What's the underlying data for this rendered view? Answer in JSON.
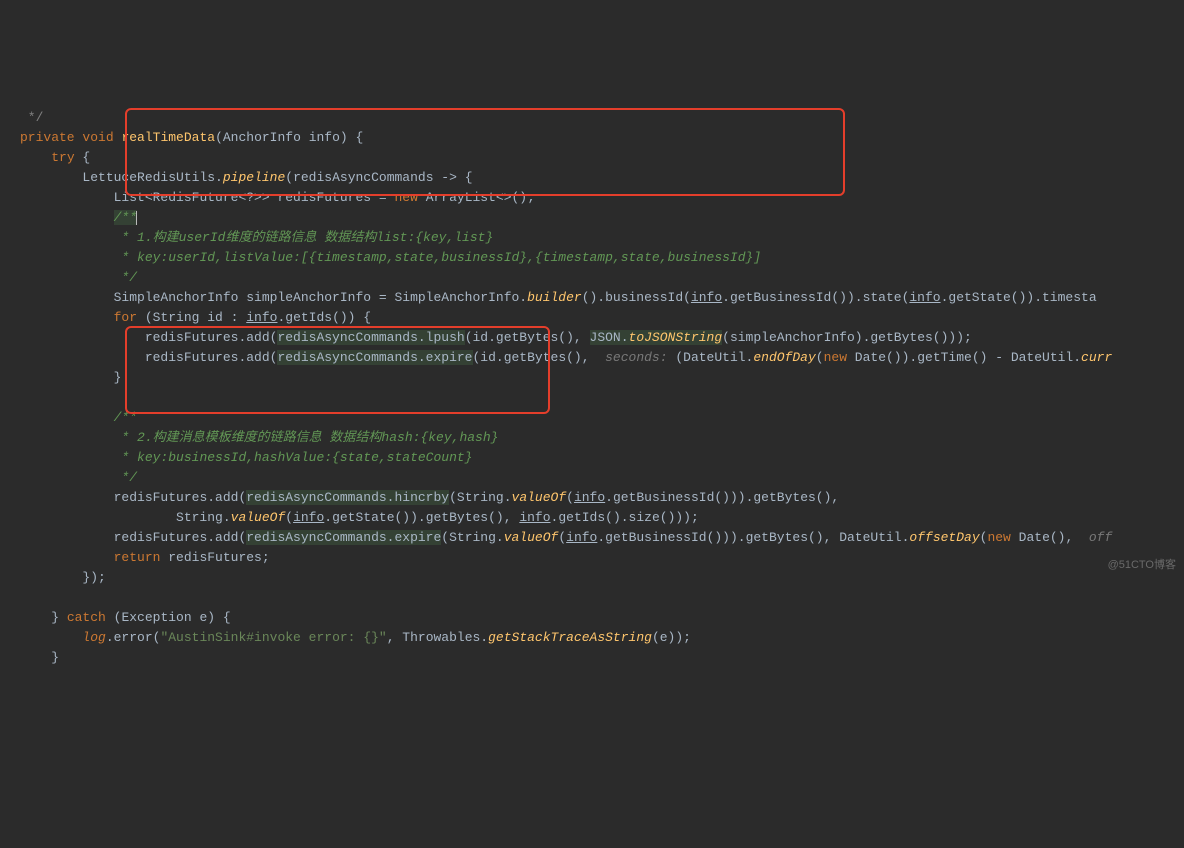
{
  "code": {
    "l01": " */",
    "l02a": "private",
    "l02b": "void",
    "l02c": "realTimeData",
    "l02d": "(AnchorInfo info) {",
    "l03a": "try",
    "l03b": " {",
    "l04a": "LettuceRedisUtils.",
    "l04b": "pipeline",
    "l04c": "(redisAsyncCommands -> {",
    "l05a": "List<RedisFuture<?>> redisFutures = ",
    "l05b": "new",
    "l05c": " ArrayList<>();",
    "l06": "/**",
    "l07": " * 1.构建userId维度的链路信息 数据结构list:{key,list}",
    "l08": " * key:userId,listValue:[{timestamp,state,businessId},{timestamp,state,businessId}]",
    "l09": " */",
    "l10a": "SimpleAnchorInfo simpleAnchorInfo = SimpleAnchorInfo.",
    "l10b": "builder",
    "l10c": "().businessId(",
    "l10d": "info",
    "l10e": ".getBusinessId()).state(",
    "l10f": "info",
    "l10g": ".getState()).timesta",
    "l11a": "for",
    "l11b": " (String id : ",
    "l11c": "info",
    "l11d": ".getIds()) {",
    "l12a": "redisFutures.add(",
    "l12b": "redisAsyncCommands.lpush",
    "l12c": "(id.getBytes(), ",
    "l12d": "JSON.",
    "l12e": "toJSONString",
    "l12f": "(simpleAnchorInfo).getBytes()));",
    "l13a": "redisFutures.add(",
    "l13b": "redisAsyncCommands.expire",
    "l13c": "(id.getBytes(), ",
    "l13hint": " seconds: ",
    "l13d": "(DateUtil.",
    "l13e": "endOfDay",
    "l13f": "(",
    "l13g": "new",
    "l13h": " Date()).getTime() - DateUtil.",
    "l13i": "curr",
    "l14": "}",
    "l15": "",
    "l16": "/**",
    "l17": " * 2.构建消息模板维度的链路信息 数据结构hash:{key,hash}",
    "l18": " * key:businessId,hashValue:{state,stateCount}",
    "l19": " */",
    "l20a": "redisFutures.add(",
    "l20b": "redisAsyncCommands.hincrby",
    "l20c": "(String.",
    "l20d": "valueOf",
    "l20e": "(",
    "l20f": "info",
    "l20g": ".getBusinessId())).getBytes(),",
    "l21a": "String.",
    "l21b": "valueOf",
    "l21c": "(",
    "l21d": "info",
    "l21e": ".getState()).getBytes(), ",
    "l21f": "info",
    "l21g": ".getIds().size()));",
    "l22a": "redisFutures.add(",
    "l22b": "redisAsyncCommands.expire",
    "l22c": "(String.",
    "l22d": "valueOf",
    "l22e": "(",
    "l22f": "info",
    "l22g": ".getBusinessId())).getBytes(), DateUtil.",
    "l22h": "offsetDay",
    "l22i": "(",
    "l22j": "new",
    "l22k": " Date(), ",
    "l22l": " off",
    "l23a": "return",
    "l23b": " redisFutures;",
    "l24": "});",
    "l25": "",
    "l26a": "} ",
    "l26b": "catch",
    "l26c": " (Exception e) {",
    "l27a": "log",
    "l27b": ".error(",
    "l27c": "\"AustinSink#invoke error: {}\"",
    "l27d": ", Throwables.",
    "l27e": "getStackTraceAsString",
    "l27f": "(e));",
    "l28": "}"
  },
  "watermark": "@51CTO博客"
}
